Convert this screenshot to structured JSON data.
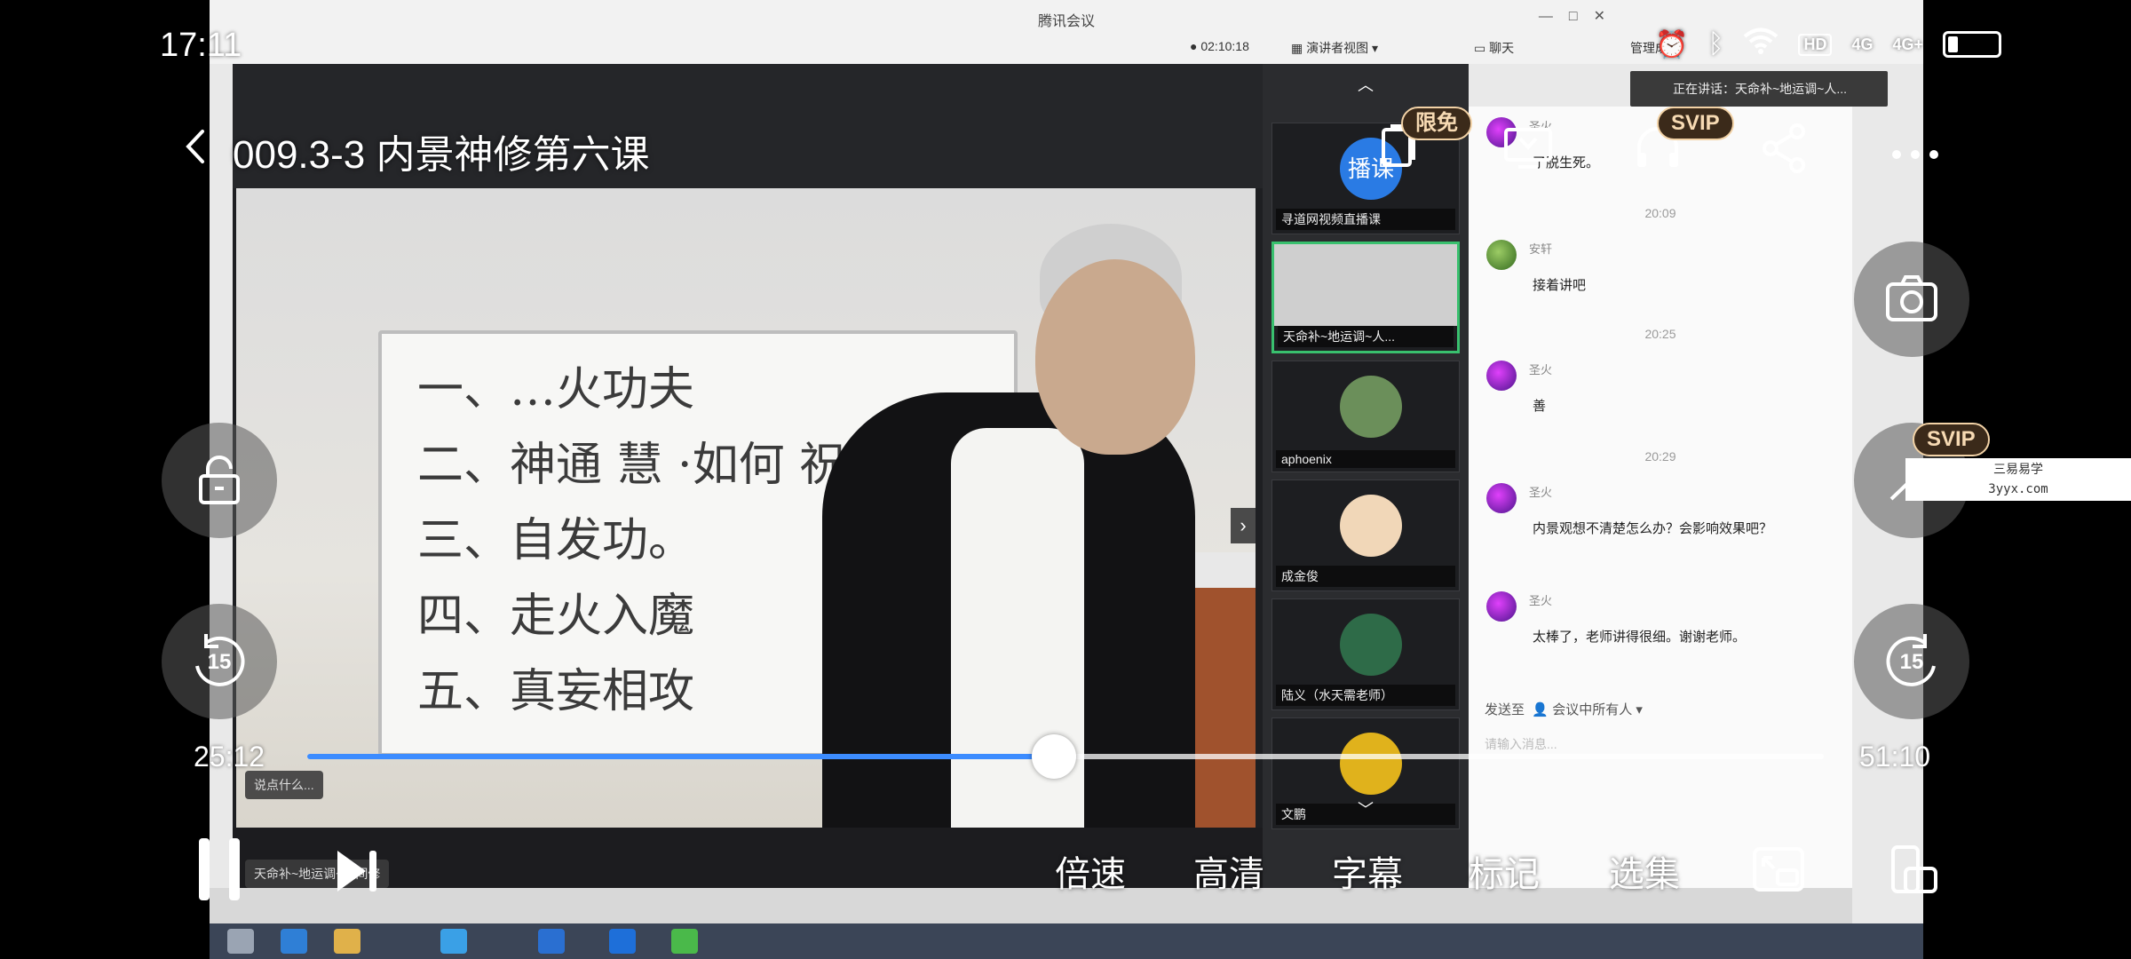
{
  "status_bar": {
    "time": "17:11",
    "network_1": "HD",
    "network_2": "4G",
    "network_3": "4G+",
    "battery_level": 0.2
  },
  "player": {
    "title": "009.3-3 内景神修第六课",
    "badges": {
      "limited_free": "限免",
      "svip": "SVIP",
      "svip_side": "SVIP"
    },
    "current_time": "25:12",
    "total_time": "51:10",
    "progress": 0.4925,
    "buffered": 0.12,
    "rewind_seconds": "15",
    "forward_seconds": "15",
    "options": [
      "倍速",
      "高清",
      "字幕",
      "标记",
      "选集"
    ]
  },
  "meeting": {
    "app_title": "腾讯会议",
    "elapsed": "02:10:18",
    "layout_label": "演讲者视图",
    "chat_label": "聊天",
    "admin_label": "管理成",
    "speaking_label": "正在讲话：天命补~地运调~人...",
    "whiteboard_lines": [
      "一、…火功夫",
      "二、神通 慧 ·如何 祝由",
      "三、自发功。",
      "四、走火入魔",
      "五、真妄相攻"
    ],
    "participants": [
      {
        "name": "寻道网视频直播课",
        "avatar_text": "播课",
        "color": "#2a7be4"
      },
      {
        "name": "天命补~地运调~人...",
        "avatar_text": "",
        "color": "#cfcfcf"
      },
      {
        "name": "aphoenix",
        "avatar_text": "",
        "color": "#6b8f5a"
      },
      {
        "name": "成金俊",
        "avatar_text": "",
        "color": "#f1d7b8"
      },
      {
        "name": "陆义（水天需老师）",
        "avatar_text": "",
        "color": "#2e6b48"
      },
      {
        "name": "文鹏",
        "avatar_text": "",
        "color": "#e0b21c"
      }
    ],
    "chat": [
      {
        "time": "",
        "name": "圣火",
        "text": "了脱生死。"
      },
      {
        "time": "20:09",
        "name": "安轩",
        "text": "接着讲吧"
      },
      {
        "time": "20:25",
        "name": "圣火",
        "text": "善"
      },
      {
        "time": "20:29",
        "name": "圣火",
        "text": "内景观想不清楚怎么办？会影响效果吧？"
      },
      {
        "time": "",
        "name": "圣火",
        "text": "太棒了，老师讲得很细。谢谢老师。"
      }
    ],
    "send_to_label": "发送至",
    "send_to_value": "会议中所有人",
    "input_placeholder": "请输入消息...",
    "stage_chip": "说点什么...",
    "speaker_chip": "天命补~地运调~人间修"
  },
  "watermark": {
    "line1": "三易易学",
    "line2": "3yyx.com"
  },
  "colors": {
    "accent": "#3c8cff",
    "active_tile": "#39c06e",
    "badge_text": "#f7dab3"
  }
}
